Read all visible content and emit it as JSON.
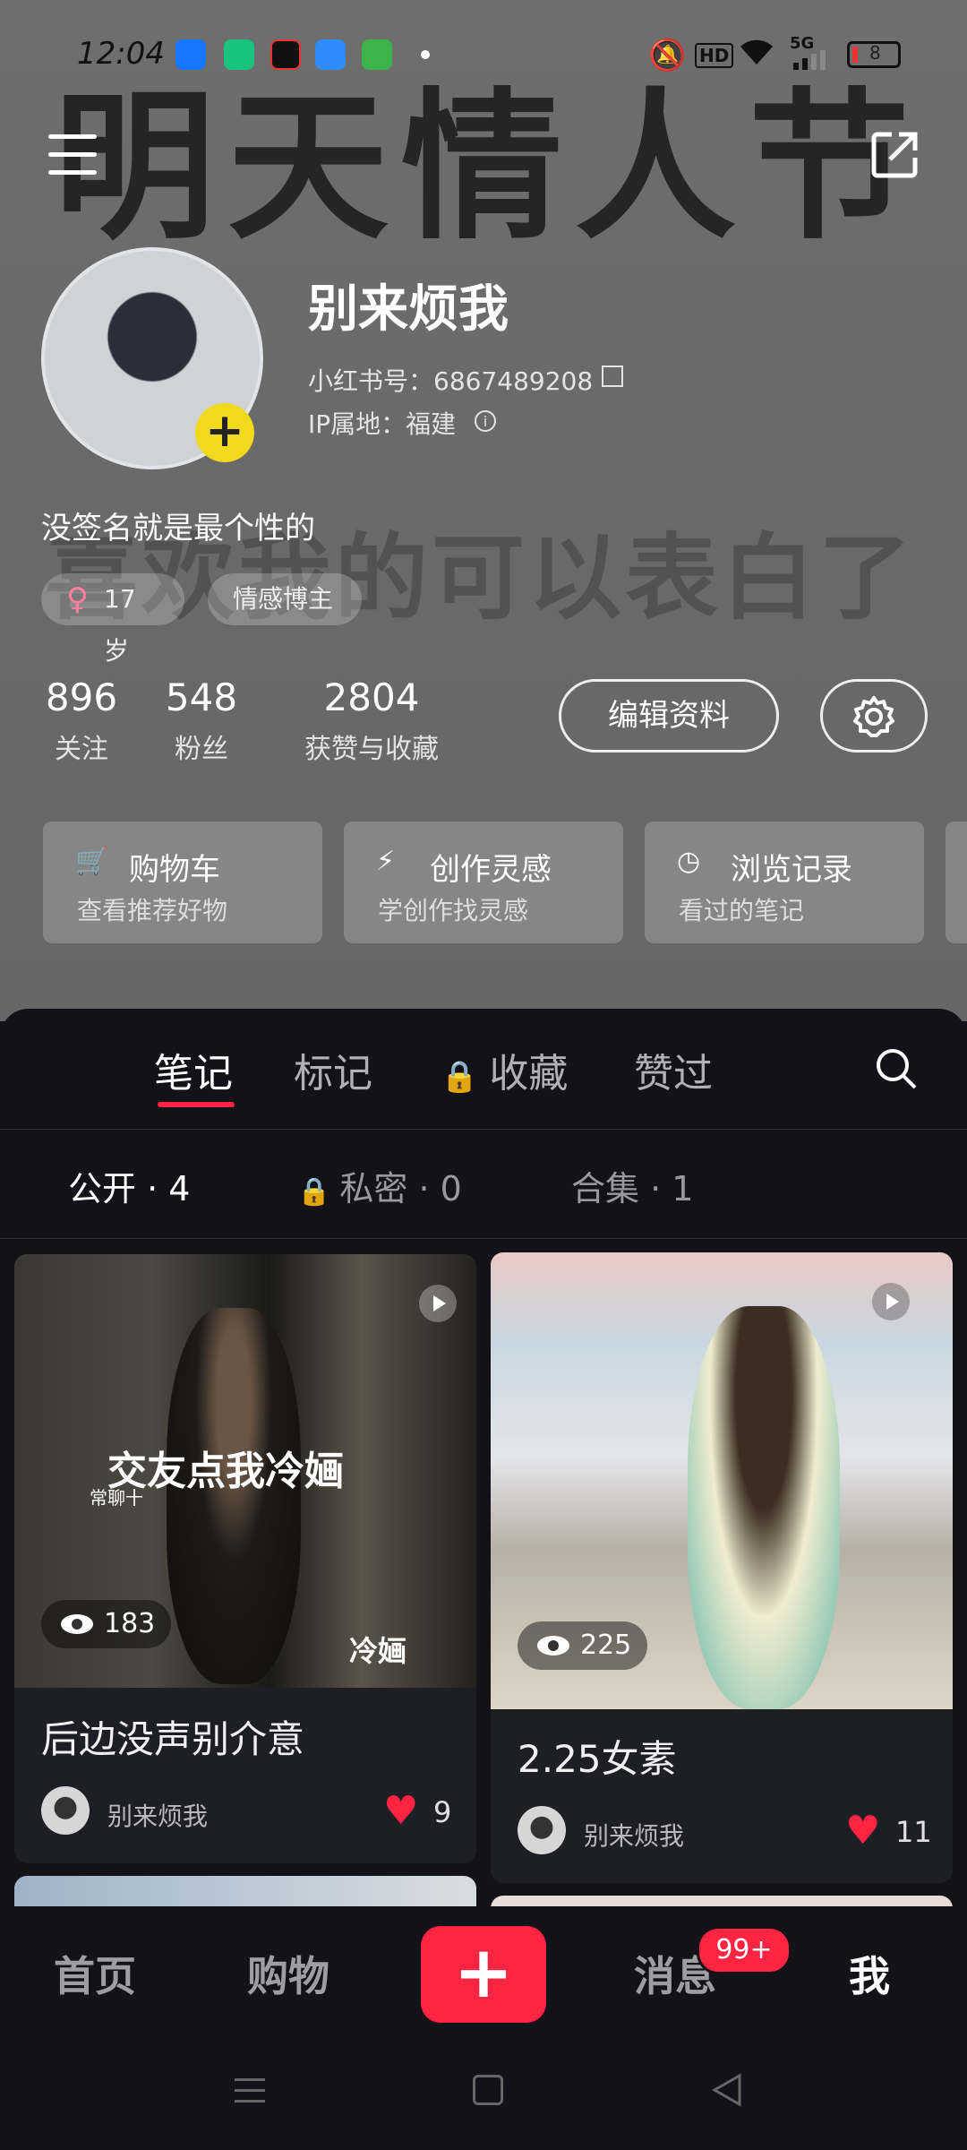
{
  "status_bar": {
    "time": "12:04",
    "battery": "8",
    "network": "5G",
    "hd_label": "HD"
  },
  "background": {
    "big_text": "明天情人节",
    "mid_text": "喜欢我的可以表白了"
  },
  "profile": {
    "name": "别来烦我",
    "id_label": "小红书号：6867489208",
    "ip_label": "IP属地：福建",
    "bio": "没签名就是最个性的",
    "tags": [
      {
        "icon": "female-icon",
        "label": "17岁"
      },
      {
        "label": "情感博主"
      }
    ],
    "stats": [
      {
        "value": "896",
        "label": "关注"
      },
      {
        "value": "548",
        "label": "粉丝"
      },
      {
        "value": "2804",
        "label": "获赞与收藏"
      }
    ],
    "edit_button": "编辑资料"
  },
  "quick_cards": [
    {
      "icon": "cart-icon",
      "title": "购物车",
      "sub": "查看推荐好物"
    },
    {
      "icon": "lightbulb-icon",
      "title": "创作灵感",
      "sub": "学创作找灵感"
    },
    {
      "icon": "clock-icon",
      "title": "浏览记录",
      "sub": "看过的笔记"
    }
  ],
  "tabs": [
    {
      "label": "笔记",
      "active": true
    },
    {
      "label": "标记"
    },
    {
      "label": "收藏",
      "locked": true
    },
    {
      "label": "赞过"
    }
  ],
  "subtabs": [
    {
      "label": "公开 · 4",
      "active": true
    },
    {
      "label": "私密 · 0",
      "locked": true
    },
    {
      "label": "合集 · 1"
    }
  ],
  "notes": [
    {
      "title": "后边没声别介意",
      "author": "别来烦我",
      "likes": "9",
      "views": "183",
      "overlay_main": "交友点我冷婳",
      "overlay_small": "常聊十",
      "overlay_corner": "冷婳"
    },
    {
      "title": "2.25女素",
      "author": "别来烦我",
      "likes": "11",
      "views": "225"
    }
  ],
  "bottom_nav": [
    {
      "label": "首页"
    },
    {
      "label": "购物"
    },
    {
      "label": "+",
      "type": "add"
    },
    {
      "label": "消息",
      "badge": "99+"
    },
    {
      "label": "我",
      "active": true
    }
  ],
  "colors": {
    "accent": "#ff2442",
    "avatar_badge": "#f2d91d",
    "panel_bg": "#121218"
  }
}
